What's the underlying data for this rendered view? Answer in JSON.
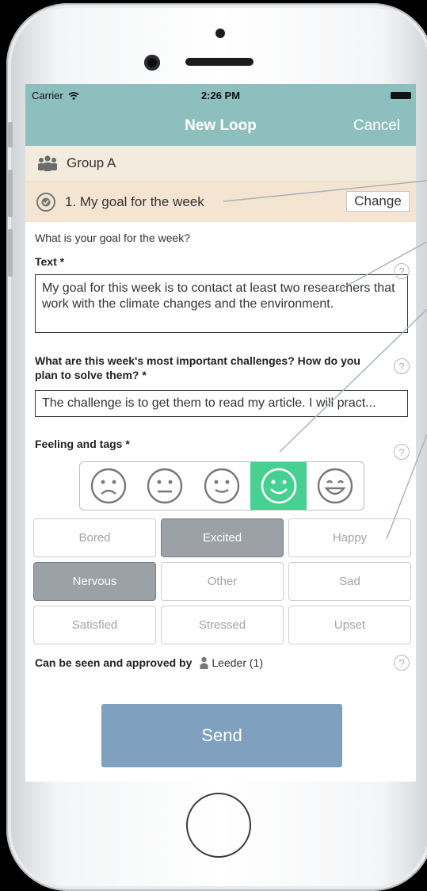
{
  "status_bar": {
    "carrier": "Carrier",
    "time": "2:26 PM"
  },
  "nav": {
    "title": "New Loop",
    "cancel_label": "Cancel"
  },
  "group": {
    "name": "Group A"
  },
  "goal": {
    "title": "1. My goal for the week",
    "change_label": "Change"
  },
  "form": {
    "goal_question": "What is your goal for the week?",
    "text_label": "Text *",
    "text_value": "My goal for this week is to contact at least two researchers that work with the climate changes and the environment.",
    "challenges_label": "What are this week's most important challenges? How do you plan to solve them? *",
    "challenges_value": "The challenge is to get them to read my article. I will pract...",
    "feeling_label": "Feeling and tags *",
    "moods": [
      {
        "name": "sad",
        "selected": false
      },
      {
        "name": "neutral",
        "selected": false
      },
      {
        "name": "slightly-happy",
        "selected": false
      },
      {
        "name": "happy",
        "selected": true
      },
      {
        "name": "very-happy",
        "selected": false
      }
    ],
    "tags": [
      {
        "label": "Bored",
        "selected": false
      },
      {
        "label": "Excited",
        "selected": true
      },
      {
        "label": "Happy",
        "selected": false
      },
      {
        "label": "Nervous",
        "selected": true
      },
      {
        "label": "Other",
        "selected": false
      },
      {
        "label": "Sad",
        "selected": false
      },
      {
        "label": "Satisfied",
        "selected": false
      },
      {
        "label": "Stressed",
        "selected": false
      },
      {
        "label": "Upset",
        "selected": false
      }
    ],
    "approval_label": "Can be seen and approved by",
    "approver": "Leeder (1)",
    "help_glyph": "?"
  },
  "send_label": "Send",
  "colors": {
    "navbar": "#8ebfbf",
    "mood_selected": "#46d092",
    "tag_selected": "#9ba1a6",
    "send_button": "#7fa1bf"
  }
}
